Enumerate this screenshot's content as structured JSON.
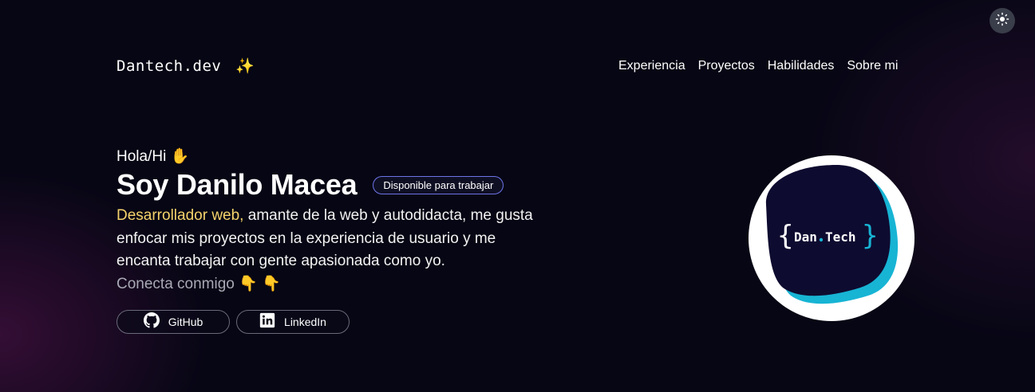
{
  "header": {
    "logo_text": "Dantech.dev",
    "logo_emoji": "✨",
    "nav": [
      "Experiencia",
      "Proyectos",
      "Habilidades",
      "Sobre mi"
    ],
    "theme_toggle_icon": "sun-icon"
  },
  "hero": {
    "greeting": "Hola/Hi",
    "greeting_emoji": "✋",
    "name": "Soy Danilo Macea",
    "badge": "Disponible para trabajar",
    "bio_highlight": "Desarrollador web,",
    "bio_rest": " amante de la web y autodidacta, me gusta enfocar mis proyectos en la experiencia de usuario y me encanta trabajar con gente apasionada como yo.",
    "connect": "Conecta conmigo",
    "connect_emoji": "👇 👇",
    "social": [
      {
        "label": "GitHub",
        "icon": "github-icon"
      },
      {
        "label": "LinkedIn",
        "icon": "linkedin-icon"
      }
    ]
  },
  "avatar": {
    "logo_text": "Dan.Tech",
    "colors": {
      "blob": "#0e0b30",
      "accent": "#17b4d4"
    }
  },
  "colors": {
    "background": "#060614",
    "highlight": "#f5d36b",
    "badge_border": "#6c74e8",
    "muted_text": "#a9a9b6"
  }
}
